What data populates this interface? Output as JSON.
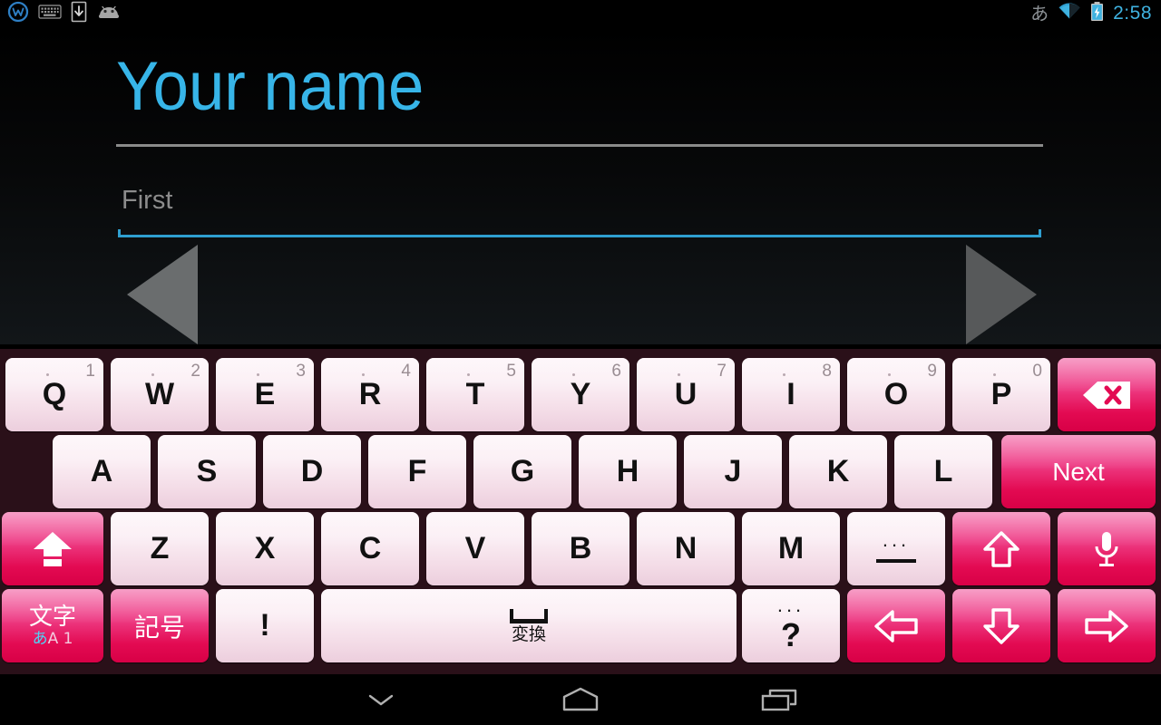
{
  "statusbar": {
    "icons_left": [
      "w-logo-icon",
      "keyboard-icon",
      "download-icon",
      "android-icon"
    ],
    "ime_indicator": "あ",
    "icons_right": [
      "wifi-icon",
      "battery-charging-icon"
    ],
    "clock": "2:58",
    "clock_color": "#3fb2e0"
  },
  "content": {
    "title": "Your name",
    "title_color": "#37b5e8",
    "field": {
      "value": "",
      "placeholder": "First",
      "underline_color": "#2f9fd0"
    },
    "nav_prev_label": "previous",
    "nav_next_label": "next"
  },
  "keyboard": {
    "background_color": "#2a1019",
    "accent_color": "#e30a52",
    "row1": [
      {
        "label": "Q",
        "num": "1",
        "dot": true
      },
      {
        "label": "W",
        "num": "2",
        "dot": true
      },
      {
        "label": "E",
        "num": "3",
        "dot": true
      },
      {
        "label": "R",
        "num": "4",
        "dot": true
      },
      {
        "label": "T",
        "num": "5",
        "dot": true
      },
      {
        "label": "Y",
        "num": "6",
        "dot": true
      },
      {
        "label": "U",
        "num": "7",
        "dot": true
      },
      {
        "label": "I",
        "num": "8",
        "dot": true
      },
      {
        "label": "O",
        "num": "9",
        "dot": true
      },
      {
        "label": "P",
        "num": "0",
        "dot": true
      }
    ],
    "row1_special": {
      "name": "backspace-key",
      "label": ""
    },
    "row2": [
      {
        "label": "A"
      },
      {
        "label": "S"
      },
      {
        "label": "D"
      },
      {
        "label": "F"
      },
      {
        "label": "G"
      },
      {
        "label": "H"
      },
      {
        "label": "J"
      },
      {
        "label": "K"
      },
      {
        "label": "L"
      }
    ],
    "row2_special": {
      "name": "enter-key",
      "label": "Next"
    },
    "row3": [
      {
        "label": "Z"
      },
      {
        "label": "X"
      },
      {
        "label": "C"
      },
      {
        "label": "V"
      },
      {
        "label": "B"
      },
      {
        "label": "N"
      },
      {
        "label": "M"
      }
    ],
    "row3_shift": {
      "name": "shift-key",
      "label": ""
    },
    "row3_dash": {
      "name": "dash-key",
      "label": "—",
      "above": "..."
    },
    "row3_up": {
      "name": "arrow-up-key",
      "label": ""
    },
    "row3_mic": {
      "name": "voice-input-key",
      "label": ""
    },
    "row4_moji": {
      "name": "character-mode-key",
      "label": "文字",
      "sub_a": "あ",
      "sub_rest": "A 1"
    },
    "row4_kigou": {
      "name": "symbols-key",
      "label": "記号"
    },
    "row4_excl": {
      "name": "exclamation-key",
      "label": "!"
    },
    "row4_space": {
      "name": "space-key",
      "label": "変換"
    },
    "row4_question": {
      "name": "question-key",
      "label": "?",
      "above": "..."
    },
    "row4_left": {
      "name": "arrow-left-key",
      "label": ""
    },
    "row4_down": {
      "name": "arrow-down-key",
      "label": ""
    },
    "row4_right": {
      "name": "arrow-right-key",
      "label": ""
    }
  },
  "navbar": {
    "back": "hide-keyboard",
    "home": "home",
    "recents": "recent-apps"
  }
}
